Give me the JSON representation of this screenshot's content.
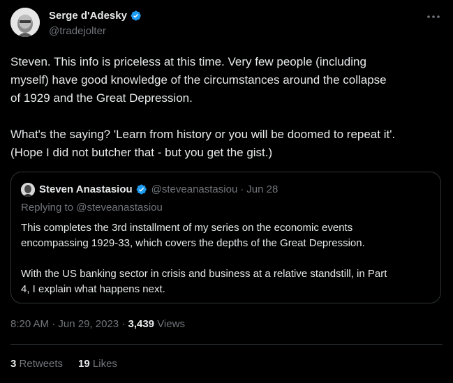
{
  "author": {
    "name": "Serge d'Adesky",
    "handle": "@tradejolter"
  },
  "tweet": {
    "paragraphs": [
      [
        "Steven.  This info is priceless at this time. Very few people (including",
        "myself) have good knowledge of the circumstances around the collapse",
        "of 1929 and the Great Depression."
      ],
      [
        "What's the saying? 'Learn from history or you will be doomed to repeat it'.",
        "(Hope I did not butcher that - but you get the gist.)"
      ]
    ]
  },
  "quote": {
    "name": "Steven Anastasiou",
    "handle": "@steveanastasiou",
    "dot": "·",
    "date": "Jun 28",
    "replying": "Replying to @steveanastasiou",
    "paragraphs": [
      [
        "This completes the 3rd installment of my series on the economic events",
        "encompassing 1929-33, which covers the depths of the Great Depression."
      ],
      [
        "With the US banking sector in crisis and business at a relative standstill, in Part",
        "4, I explain what happens next."
      ]
    ]
  },
  "meta": {
    "time": "8:20 AM",
    "dot": "·",
    "date": "Jun 29, 2023",
    "views_count": "3,439",
    "views_label": "Views"
  },
  "stats": {
    "retweets_count": "3",
    "retweets_label": "Retweets",
    "likes_count": "19",
    "likes_label": "Likes"
  },
  "colors": {
    "background": "#000000",
    "text": "#e7e9ea",
    "secondary": "#71767b",
    "border": "#2f3336",
    "verified": "#1d9bf0"
  },
  "icons": {
    "verified": "verified-badge-icon",
    "more": "more-options-icon"
  }
}
